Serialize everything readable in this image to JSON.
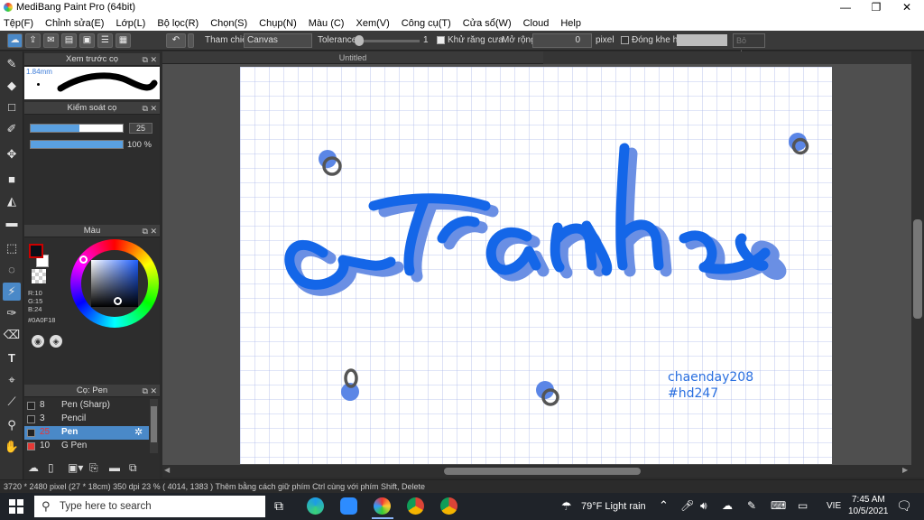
{
  "window": {
    "title": "MediBang Paint Pro (64bit)",
    "minimize": "—",
    "maximize": "❐",
    "close": "✕"
  },
  "menu": [
    "Tệp(F)",
    "Chỉnh sửa(E)",
    "Lớp(L)",
    "Bộ lọc(R)",
    "Chọn(S)",
    "Chụp(N)",
    "Màu (C)",
    "Xem(V)",
    "Công cụ(T)",
    "Cửa sổ(W)",
    "Cloud",
    "Help"
  ],
  "toolbar": {
    "reference_label": "Tham chiếu",
    "reference_value": "Canvas",
    "tolerance_label": "Tolerance",
    "tolerance_value": "1",
    "antialias_label": "Khử răng cưa",
    "expand_label": "Mở rộng",
    "expand_value": "0",
    "expand_unit": "pixel",
    "close_gap_label": "Đóng khe hở",
    "deselect_label": "Bỏ chọn"
  },
  "panels": {
    "brush_preview": {
      "title": "Xem trước cọ",
      "size_label": "1.84mm"
    },
    "brush_control": {
      "title": "Kiểm soát cọ",
      "size": "25",
      "opacity": "100 %",
      "size_level": 0.53,
      "opacity_level": 1.0
    },
    "color": {
      "title": "Màu",
      "r": "R:10",
      "g": "G:15",
      "b": "B:24",
      "hex": "#0A0F18",
      "fg": "#0a0f18",
      "bg": "#ffffff"
    },
    "brushes": {
      "title": "Cọ: Pen",
      "items": [
        {
          "size": "8",
          "name": "Pen (Sharp)",
          "selected": false,
          "color": "#222222"
        },
        {
          "size": "3",
          "name": "Pencil",
          "selected": false,
          "color": "#222222"
        },
        {
          "size": "25",
          "name": "Pen",
          "selected": true,
          "color": "#222222"
        },
        {
          "size": "10",
          "name": "G Pen",
          "selected": false,
          "color": "#e53935"
        }
      ]
    }
  },
  "document": {
    "tab_title": "Untitled",
    "artwork_text": "tranh",
    "watermark_line1": "chaenday208",
    "watermark_line2": "#hd247"
  },
  "status": {
    "text": "3720 * 2480 pixel   (27 * 18cm)   350 dpi   23 %   ( 4014, 1383 )   Thêm bằng cách giữ phím Ctrl cùng với phím Shift, Delete"
  },
  "taskbar": {
    "search_placeholder": "Type here to search",
    "weather": "79°F  Light rain",
    "language": "VIE",
    "time": "7:45 AM",
    "date": "10/5/2021"
  },
  "colors": {
    "accent": "#4a89c8",
    "ink_blue": "#1565e6",
    "ink_shadow": "#6c8ee0",
    "grid": "#a9b6e8"
  }
}
